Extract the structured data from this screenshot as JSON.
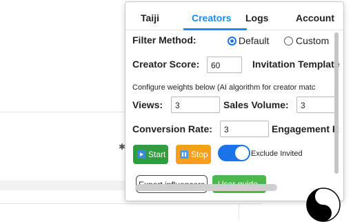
{
  "tabs": [
    "Taiji",
    "Creators",
    "Logs",
    "Account"
  ],
  "active_tab": "Creators",
  "filter": {
    "label": "Filter Method:",
    "options": [
      "Default",
      "Custom"
    ],
    "selected": "Default"
  },
  "creator_score": {
    "label": "Creator Score:",
    "value": "60"
  },
  "invitation_template": {
    "label": "Invitation Template"
  },
  "weights_hint": "Configure weights below (AI algorithm for creator matc",
  "views": {
    "label": "Views:",
    "value": "3"
  },
  "sales_volume": {
    "label": "Sales Volume:",
    "value": "3"
  },
  "conversion_rate": {
    "label": "Conversion Rate:",
    "value": "3"
  },
  "engagement": {
    "label": "Engagement R"
  },
  "buttons": {
    "start": "Start",
    "stop": "Stop",
    "export": "Export influencers",
    "guide": "User guide"
  },
  "exclude_invited": {
    "label": "Exclude Invited",
    "enabled": true
  },
  "colors": {
    "accent": "#1a8cf0",
    "start": "#2e9e3e",
    "stop": "#f4a018",
    "guide": "#4cb84c"
  }
}
